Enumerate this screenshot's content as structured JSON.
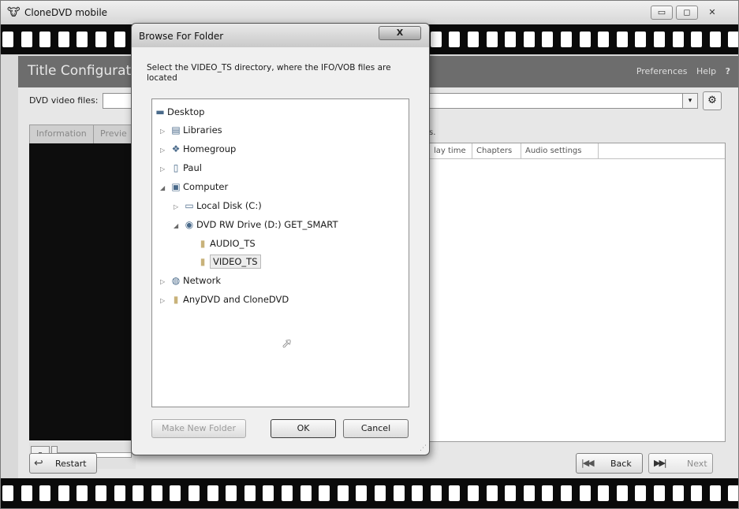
{
  "window": {
    "title": "CloneDVD mobile",
    "controls": {
      "minimize": "▭",
      "maximize": "◻",
      "close": "✕"
    }
  },
  "header": {
    "section_title": "Title Configurati",
    "links": {
      "preferences": "Preferences",
      "help": "Help",
      "question": "?"
    }
  },
  "source": {
    "label": "DVD video files:",
    "value": "",
    "dropdown_icon": "▾"
  },
  "left_tabs": [
    "Information",
    "Previe"
  ],
  "titles": {
    "hint": "s.",
    "columns": [
      "lay time",
      "Chapters",
      "Audio settings"
    ]
  },
  "player": {
    "pause_icon": "⏸"
  },
  "footer": {
    "restart": "Restart",
    "back": "Back",
    "next": "Next",
    "back_icon": "|◀◀",
    "next_icon": "▶▶|"
  },
  "dialog": {
    "title": "Browse For Folder",
    "close": "X",
    "instruction": "Select the VIDEO_TS directory, where the IFO/VOB files are located",
    "tree": [
      {
        "label": "Desktop",
        "icon": "desktop-icon",
        "expander": "",
        "level": 0
      },
      {
        "label": "Libraries",
        "icon": "libraries-icon",
        "expander": "▷",
        "level": 0
      },
      {
        "label": "Homegroup",
        "icon": "homegroup-icon",
        "expander": "▷",
        "level": 0
      },
      {
        "label": "Paul",
        "icon": "user-folder-icon",
        "expander": "▷",
        "level": 0
      },
      {
        "label": "Computer",
        "icon": "computer-icon",
        "expander": "◢",
        "level": 0
      },
      {
        "label": "Local Disk (C:)",
        "icon": "hard-drive-icon",
        "expander": "▷",
        "level": 1
      },
      {
        "label": "DVD RW Drive (D:) GET_SMART",
        "icon": "dvd-drive-icon",
        "expander": "◢",
        "level": 1
      },
      {
        "label": "AUDIO_TS",
        "icon": "folder-icon",
        "expander": "",
        "level": 2
      },
      {
        "label": "VIDEO_TS",
        "icon": "folder-icon",
        "expander": "",
        "level": 2,
        "selected": true
      },
      {
        "label": "Network",
        "icon": "network-icon",
        "expander": "▷",
        "level": 0
      },
      {
        "label": "AnyDVD and CloneDVD",
        "icon": "folder-icon",
        "expander": "▷",
        "level": 0
      }
    ],
    "buttons": {
      "make_new_folder": "Make New Folder",
      "ok": "OK",
      "cancel": "Cancel"
    }
  }
}
